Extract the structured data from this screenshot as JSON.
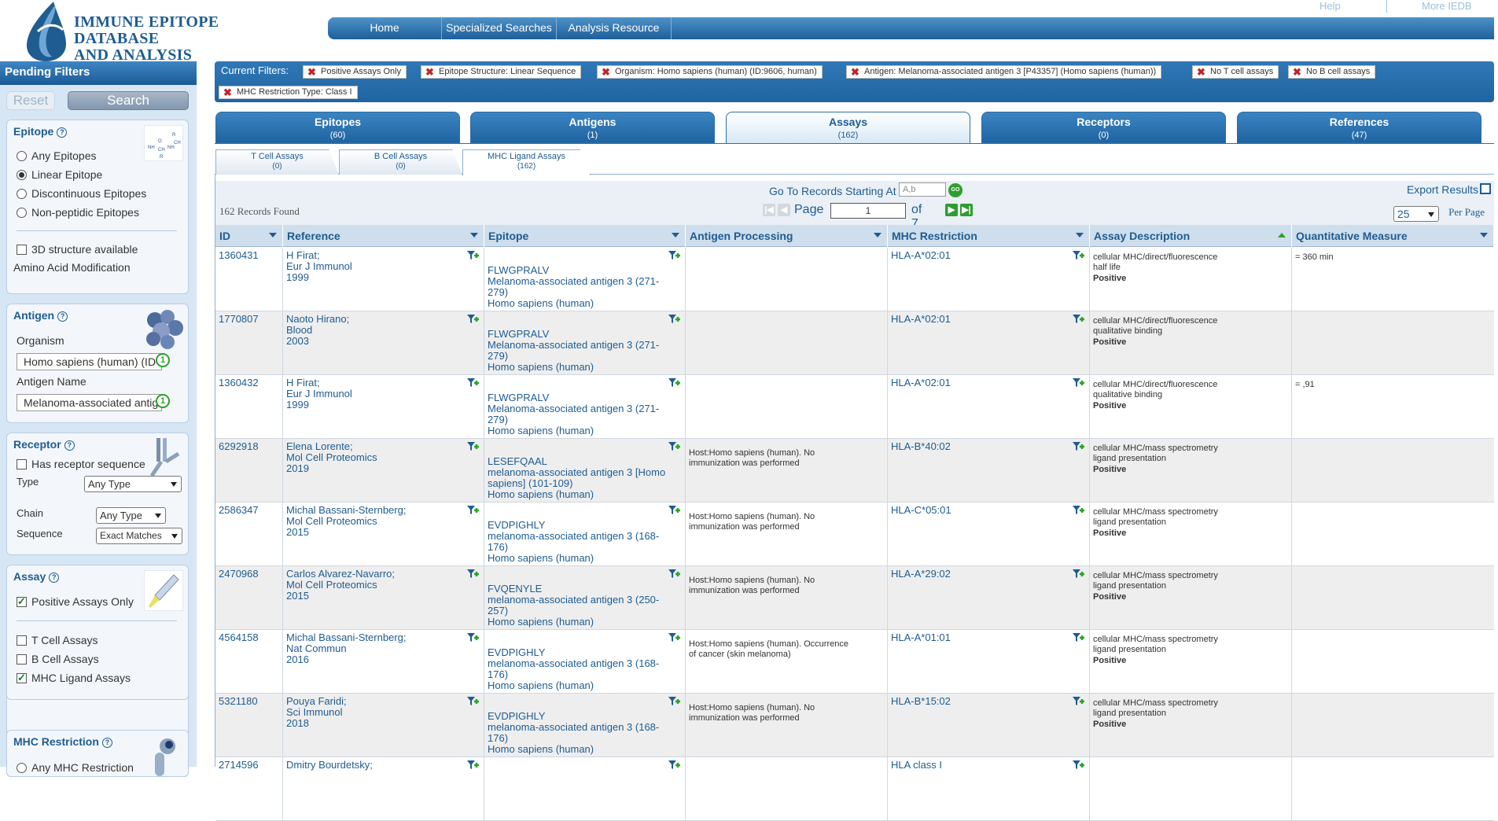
{
  "header": {
    "logo_line1": "IMMUNE EPITOPE DATABASE",
    "logo_line2": "AND ANALYSIS RESOURCE",
    "nav": [
      "Home",
      "Specialized Searches",
      "Analysis Resource"
    ],
    "help_link": "Help",
    "more_link": "More IEDB"
  },
  "pending": {
    "title": "Pending Filters",
    "reset": "Reset",
    "search": "Search",
    "epitope": {
      "title": "Epitope",
      "options": [
        "Any Epitopes",
        "Linear Epitope",
        "Discontinuous Epitopes",
        "Non-peptidic Epitopes"
      ],
      "selected": 1,
      "structure3d": "3D structure available",
      "aa_mod": "Amino Acid Modification"
    },
    "antigen": {
      "title": "Antigen",
      "organism_label": "Organism",
      "organism_value": "Homo sapiens (human) (ID",
      "organism_count": "1",
      "name_label": "Antigen Name",
      "name_value": "Melanoma-associated antig",
      "name_count": "1"
    },
    "receptor": {
      "title": "Receptor",
      "has_seq": "Has receptor sequence",
      "type_label": "Type",
      "type_value": "Any Type",
      "chain_label": "Chain",
      "chain_value": "Any Type",
      "seq_label": "Sequence",
      "seq_value": "Exact Matches"
    },
    "assay": {
      "title": "Assay",
      "positive": "Positive Assays Only",
      "tcell": "T Cell Assays",
      "bcell": "B Cell Assays",
      "mhc": "MHC Ligand Assays"
    },
    "mhc": {
      "title": "MHC Restriction",
      "option": "Any MHC Restriction"
    }
  },
  "current_filters": {
    "label": "Current Filters:",
    "chips": [
      "Positive Assays Only",
      "Epitope Structure: Linear Sequence",
      "Organism: Homo sapiens (human) (ID:9606, human)",
      "Antigen: Melanoma-associated antigen 3 [P43357] (Homo sapiens (human))",
      "No T cell assays",
      "No B cell assays",
      "MHC Restriction Type: Class I"
    ]
  },
  "tabs": [
    {
      "label": "Epitopes",
      "count": "(60)"
    },
    {
      "label": "Antigens",
      "count": "(1)"
    },
    {
      "label": "Assays",
      "count": "(162)"
    },
    {
      "label": "Receptors",
      "count": "(0)"
    },
    {
      "label": "References",
      "count": "(47)"
    }
  ],
  "subtabs": [
    {
      "label": "T Cell Assays",
      "count": "(0)"
    },
    {
      "label": "B Cell Assays",
      "count": "(0)"
    },
    {
      "label": "MHC Ligand Assays",
      "count": "(162)"
    }
  ],
  "toolbar": {
    "goto_label": "Go To Records Starting At",
    "goto_placeholder": "A,b",
    "go": "GO",
    "export": "Export Results",
    "records_found": "162 Records Found",
    "page_label": "Page",
    "page_value": "1",
    "page_of": "of 7",
    "per_page_value": "25",
    "per_page_label": "Per Page"
  },
  "columns": [
    "ID",
    "Reference",
    "Epitope",
    "Antigen Processing",
    "MHC Restriction",
    "Assay Description",
    "Quantitative Measure"
  ],
  "rows": [
    {
      "id": "1360431",
      "ref": [
        "H Firat;",
        "Eur J Immunol",
        "1999"
      ],
      "epi": [
        "FLWGPRALV",
        "Melanoma-associated antigen 3 (271-",
        "279)",
        "Homo sapiens (human)"
      ],
      "proc": [
        "",
        ""
      ],
      "mhc": "HLA-A*02:01",
      "desc": [
        "cellular MHC/direct/fluorescence",
        "half life",
        "Positive"
      ],
      "quant": "= 360 min"
    },
    {
      "id": "1770807",
      "ref": [
        "Naoto Hirano;",
        "Blood",
        "2003"
      ],
      "epi": [
        "FLWGPRALV",
        "Melanoma-associated antigen 3 (271-",
        "279)",
        "Homo sapiens (human)"
      ],
      "proc": [
        "",
        ""
      ],
      "mhc": "HLA-A*02:01",
      "desc": [
        "cellular MHC/direct/fluorescence",
        "qualitative binding",
        "Positive"
      ],
      "quant": ""
    },
    {
      "id": "1360432",
      "ref": [
        "H Firat;",
        "Eur J Immunol",
        "1999"
      ],
      "epi": [
        "FLWGPRALV",
        "Melanoma-associated antigen 3 (271-",
        "279)",
        "Homo sapiens (human)"
      ],
      "proc": [
        "",
        ""
      ],
      "mhc": "HLA-A*02:01",
      "desc": [
        "cellular MHC/direct/fluorescence",
        "qualitative binding",
        "Positive"
      ],
      "quant": "= ,91"
    },
    {
      "id": "6292918",
      "ref": [
        "Elena Lorente;",
        "Mol Cell Proteomics",
        "2019"
      ],
      "epi": [
        "LESEFQAAL",
        "melanoma-associated antigen 3 [Homo",
        "sapiens] (101-109)",
        "Homo sapiens (human)"
      ],
      "proc": [
        "Host:Homo sapiens (human). No",
        "immunization was performed"
      ],
      "mhc": "HLA-B*40:02",
      "desc": [
        "cellular MHC/mass spectrometry",
        "ligand presentation",
        "Positive"
      ],
      "quant": ""
    },
    {
      "id": "2586347",
      "ref": [
        "Michal Bassani-Sternberg;",
        "Mol Cell Proteomics",
        "2015"
      ],
      "epi": [
        "EVDPIGHLY",
        "melanoma-associated antigen 3 (168-",
        "176)",
        "Homo sapiens (human)"
      ],
      "proc": [
        "Host:Homo sapiens (human). No",
        "immunization was performed"
      ],
      "mhc": "HLA-C*05:01",
      "desc": [
        "cellular MHC/mass spectrometry",
        "ligand presentation",
        "Positive"
      ],
      "quant": ""
    },
    {
      "id": "2470968",
      "ref": [
        "Carlos Alvarez-Navarro;",
        "Mol Cell Proteomics",
        "2015"
      ],
      "epi": [
        "FVQENYLE",
        "melanoma-associated antigen 3 (250-",
        "257)",
        "Homo sapiens (human)"
      ],
      "proc": [
        "Host:Homo sapiens (human). No",
        "immunization was performed"
      ],
      "mhc": "HLA-A*29:02",
      "desc": [
        "cellular MHC/mass spectrometry",
        "ligand presentation",
        "Positive"
      ],
      "quant": ""
    },
    {
      "id": "4564158",
      "ref": [
        "Michal Bassani-Sternberg;",
        "Nat Commun",
        "2016"
      ],
      "epi": [
        "EVDPIGHLY",
        "melanoma-associated antigen 3 (168-",
        "176)",
        "Homo sapiens (human)"
      ],
      "proc": [
        "Host:Homo sapiens (human). Occurrence",
        "of cancer (skin melanoma)"
      ],
      "mhc": "HLA-A*01:01",
      "desc": [
        "cellular MHC/mass spectrometry",
        "ligand presentation",
        "Positive"
      ],
      "quant": ""
    },
    {
      "id": "5321180",
      "ref": [
        "Pouya Faridi;",
        "Sci Immunol",
        "2018"
      ],
      "epi": [
        "EVDPIGHLY",
        "melanoma-associated antigen 3 (168-",
        "176)",
        "Homo sapiens (human)"
      ],
      "proc": [
        "Host:Homo sapiens (human). No",
        "immunization was performed"
      ],
      "mhc": "HLA-B*15:02",
      "desc": [
        "cellular MHC/mass spectrometry",
        "ligand presentation",
        "Positive"
      ],
      "quant": ""
    },
    {
      "id": "2714596",
      "ref": [
        "Dmitry Bourdetsky;",
        "",
        ""
      ],
      "epi": [
        "",
        "",
        "",
        ""
      ],
      "proc": [
        "",
        ""
      ],
      "mhc": "HLA class I",
      "desc": [
        "",
        "",
        ""
      ],
      "quant": ""
    }
  ]
}
